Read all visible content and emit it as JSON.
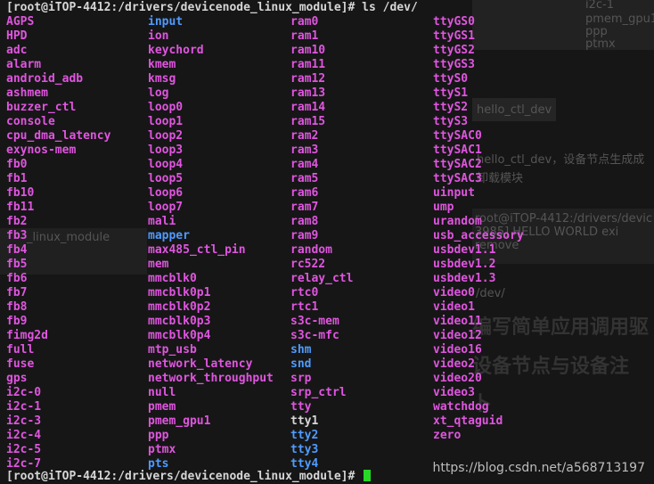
{
  "terminal": {
    "prompt_line": "[root@iTOP-4412:/drivers/devicenode_linux_module]# ls /dev/",
    "bottom_prompt": "[root@iTOP-4412:/drivers/devicenode_linux_module]# ",
    "colors": {
      "device": "#e055e0",
      "directory": "#4f9bff",
      "file": "#d6d6d6",
      "link": "#31c9c9",
      "cursor": "#27d827"
    },
    "columns": [
      [
        {
          "name": "AGPS",
          "type": "dev"
        },
        {
          "name": "HPD",
          "type": "dev"
        },
        {
          "name": "adc",
          "type": "dev"
        },
        {
          "name": "alarm",
          "type": "dev"
        },
        {
          "name": "android_adb",
          "type": "dev"
        },
        {
          "name": "ashmem",
          "type": "dev"
        },
        {
          "name": "buzzer_ctl",
          "type": "dev"
        },
        {
          "name": "console",
          "type": "dev"
        },
        {
          "name": "cpu_dma_latency",
          "type": "dev"
        },
        {
          "name": "exynos-mem",
          "type": "dev"
        },
        {
          "name": "fb0",
          "type": "dev"
        },
        {
          "name": "fb1",
          "type": "dev"
        },
        {
          "name": "fb10",
          "type": "dev"
        },
        {
          "name": "fb11",
          "type": "dev"
        },
        {
          "name": "fb2",
          "type": "dev"
        },
        {
          "name": "fb3",
          "type": "dev"
        },
        {
          "name": "fb4",
          "type": "dev"
        },
        {
          "name": "fb5",
          "type": "dev"
        },
        {
          "name": "fb6",
          "type": "dev"
        },
        {
          "name": "fb7",
          "type": "dev"
        },
        {
          "name": "fb8",
          "type": "dev"
        },
        {
          "name": "fb9",
          "type": "dev"
        },
        {
          "name": "fimg2d",
          "type": "dev"
        },
        {
          "name": "full",
          "type": "dev"
        },
        {
          "name": "fuse",
          "type": "dev"
        },
        {
          "name": "gps",
          "type": "dev"
        },
        {
          "name": "i2c-0",
          "type": "dev"
        },
        {
          "name": "i2c-1",
          "type": "dev"
        },
        {
          "name": "i2c-3",
          "type": "dev"
        },
        {
          "name": "i2c-4",
          "type": "dev"
        },
        {
          "name": "i2c-5",
          "type": "dev"
        },
        {
          "name": "i2c-7",
          "type": "dev"
        }
      ],
      [
        {
          "name": "input",
          "type": "dir"
        },
        {
          "name": "ion",
          "type": "dev"
        },
        {
          "name": "keychord",
          "type": "dev"
        },
        {
          "name": "kmem",
          "type": "dev"
        },
        {
          "name": "kmsg",
          "type": "dev"
        },
        {
          "name": "log",
          "type": "dev"
        },
        {
          "name": "loop0",
          "type": "dev"
        },
        {
          "name": "loop1",
          "type": "dev"
        },
        {
          "name": "loop2",
          "type": "dev"
        },
        {
          "name": "loop3",
          "type": "dev"
        },
        {
          "name": "loop4",
          "type": "dev"
        },
        {
          "name": "loop5",
          "type": "dev"
        },
        {
          "name": "loop6",
          "type": "dev"
        },
        {
          "name": "loop7",
          "type": "dev"
        },
        {
          "name": "mali",
          "type": "dev"
        },
        {
          "name": "mapper",
          "type": "dir"
        },
        {
          "name": "max485_ctl_pin",
          "type": "dev"
        },
        {
          "name": "mem",
          "type": "dev"
        },
        {
          "name": "mmcblk0",
          "type": "dev"
        },
        {
          "name": "mmcblk0p1",
          "type": "dev"
        },
        {
          "name": "mmcblk0p2",
          "type": "dev"
        },
        {
          "name": "mmcblk0p3",
          "type": "dev"
        },
        {
          "name": "mmcblk0p4",
          "type": "dev"
        },
        {
          "name": "mtp_usb",
          "type": "dev"
        },
        {
          "name": "network_latency",
          "type": "dev"
        },
        {
          "name": "network_throughput",
          "type": "dev"
        },
        {
          "name": "null",
          "type": "dev"
        },
        {
          "name": "pmem",
          "type": "dev"
        },
        {
          "name": "pmem_gpu1",
          "type": "dev"
        },
        {
          "name": "ppp",
          "type": "dev"
        },
        {
          "name": "ptmx",
          "type": "dev"
        },
        {
          "name": "pts",
          "type": "dir"
        }
      ],
      [
        {
          "name": "ram0",
          "type": "dev"
        },
        {
          "name": "ram1",
          "type": "dev"
        },
        {
          "name": "ram10",
          "type": "dev"
        },
        {
          "name": "ram11",
          "type": "dev"
        },
        {
          "name": "ram12",
          "type": "dev"
        },
        {
          "name": "ram13",
          "type": "dev"
        },
        {
          "name": "ram14",
          "type": "dev"
        },
        {
          "name": "ram15",
          "type": "dev"
        },
        {
          "name": "ram2",
          "type": "dev"
        },
        {
          "name": "ram3",
          "type": "dev"
        },
        {
          "name": "ram4",
          "type": "dev"
        },
        {
          "name": "ram5",
          "type": "dev"
        },
        {
          "name": "ram6",
          "type": "dev"
        },
        {
          "name": "ram7",
          "type": "dev"
        },
        {
          "name": "ram8",
          "type": "dev"
        },
        {
          "name": "ram9",
          "type": "dev"
        },
        {
          "name": "random",
          "type": "dev"
        },
        {
          "name": "rc522",
          "type": "dev"
        },
        {
          "name": "relay_ctl",
          "type": "dev"
        },
        {
          "name": "rtc0",
          "type": "dev"
        },
        {
          "name": "rtc1",
          "type": "dev"
        },
        {
          "name": "s3c-mem",
          "type": "dev"
        },
        {
          "name": "s3c-mfc",
          "type": "dev"
        },
        {
          "name": "shm",
          "type": "dir"
        },
        {
          "name": "snd",
          "type": "dir"
        },
        {
          "name": "srp",
          "type": "dev"
        },
        {
          "name": "srp_ctrl",
          "type": "dev"
        },
        {
          "name": "tty",
          "type": "dev"
        },
        {
          "name": "tty1",
          "type": "file"
        },
        {
          "name": "tty2",
          "type": "dir"
        },
        {
          "name": "tty3",
          "type": "dir"
        },
        {
          "name": "tty4",
          "type": "dir"
        }
      ],
      [
        {
          "name": "ttyGS0",
          "type": "dev"
        },
        {
          "name": "ttyGS1",
          "type": "dev"
        },
        {
          "name": "ttyGS2",
          "type": "dev"
        },
        {
          "name": "ttyGS3",
          "type": "dev"
        },
        {
          "name": "ttyS0",
          "type": "dev"
        },
        {
          "name": "ttyS1",
          "type": "dev"
        },
        {
          "name": "ttyS2",
          "type": "dev"
        },
        {
          "name": "ttyS3",
          "type": "dev"
        },
        {
          "name": "ttySAC0",
          "type": "dev"
        },
        {
          "name": "ttySAC1",
          "type": "dev"
        },
        {
          "name": "ttySAC2",
          "type": "dev"
        },
        {
          "name": "ttySAC3",
          "type": "dev"
        },
        {
          "name": "uinput",
          "type": "dev"
        },
        {
          "name": "ump",
          "type": "dev"
        },
        {
          "name": "urandom",
          "type": "dev"
        },
        {
          "name": "usb_accessory",
          "type": "dev"
        },
        {
          "name": "usbdev1.1",
          "type": "dev"
        },
        {
          "name": "usbdev1.2",
          "type": "dev"
        },
        {
          "name": "usbdev1.3",
          "type": "dev"
        },
        {
          "name": "video0",
          "type": "dev"
        },
        {
          "name": "video1",
          "type": "dev"
        },
        {
          "name": "video11",
          "type": "dev"
        },
        {
          "name": "video12",
          "type": "dev"
        },
        {
          "name": "video16",
          "type": "dev"
        },
        {
          "name": "video2",
          "type": "dev"
        },
        {
          "name": "video20",
          "type": "dev"
        },
        {
          "name": "video3",
          "type": "dev"
        },
        {
          "name": "watchdog",
          "type": "dev"
        },
        {
          "name": "xt_qtaguid",
          "type": "dev"
        },
        {
          "name": "zero",
          "type": "dev"
        }
      ]
    ]
  },
  "background_page": {
    "fragments": [
      "i2c-1",
      "pmem",
      "pmem_gpu1",
      "ppp",
      "ptmx",
      "hello_ctl_dev",
      "hello_ctl_dev，设备节点生成成",
      "卸载模块",
      "root@iTOP-4412:/drivers/devic",
      "3985] HELLO WORLD exi",
      "remove",
      "_linux_module",
      "/dev/"
    ],
    "heading_1": "编写简单应用调用驱",
    "heading_2": "设备节点与设备注",
    "heading_3": "卜"
  },
  "watermark": "https://blog.csdn.net/a568713197"
}
